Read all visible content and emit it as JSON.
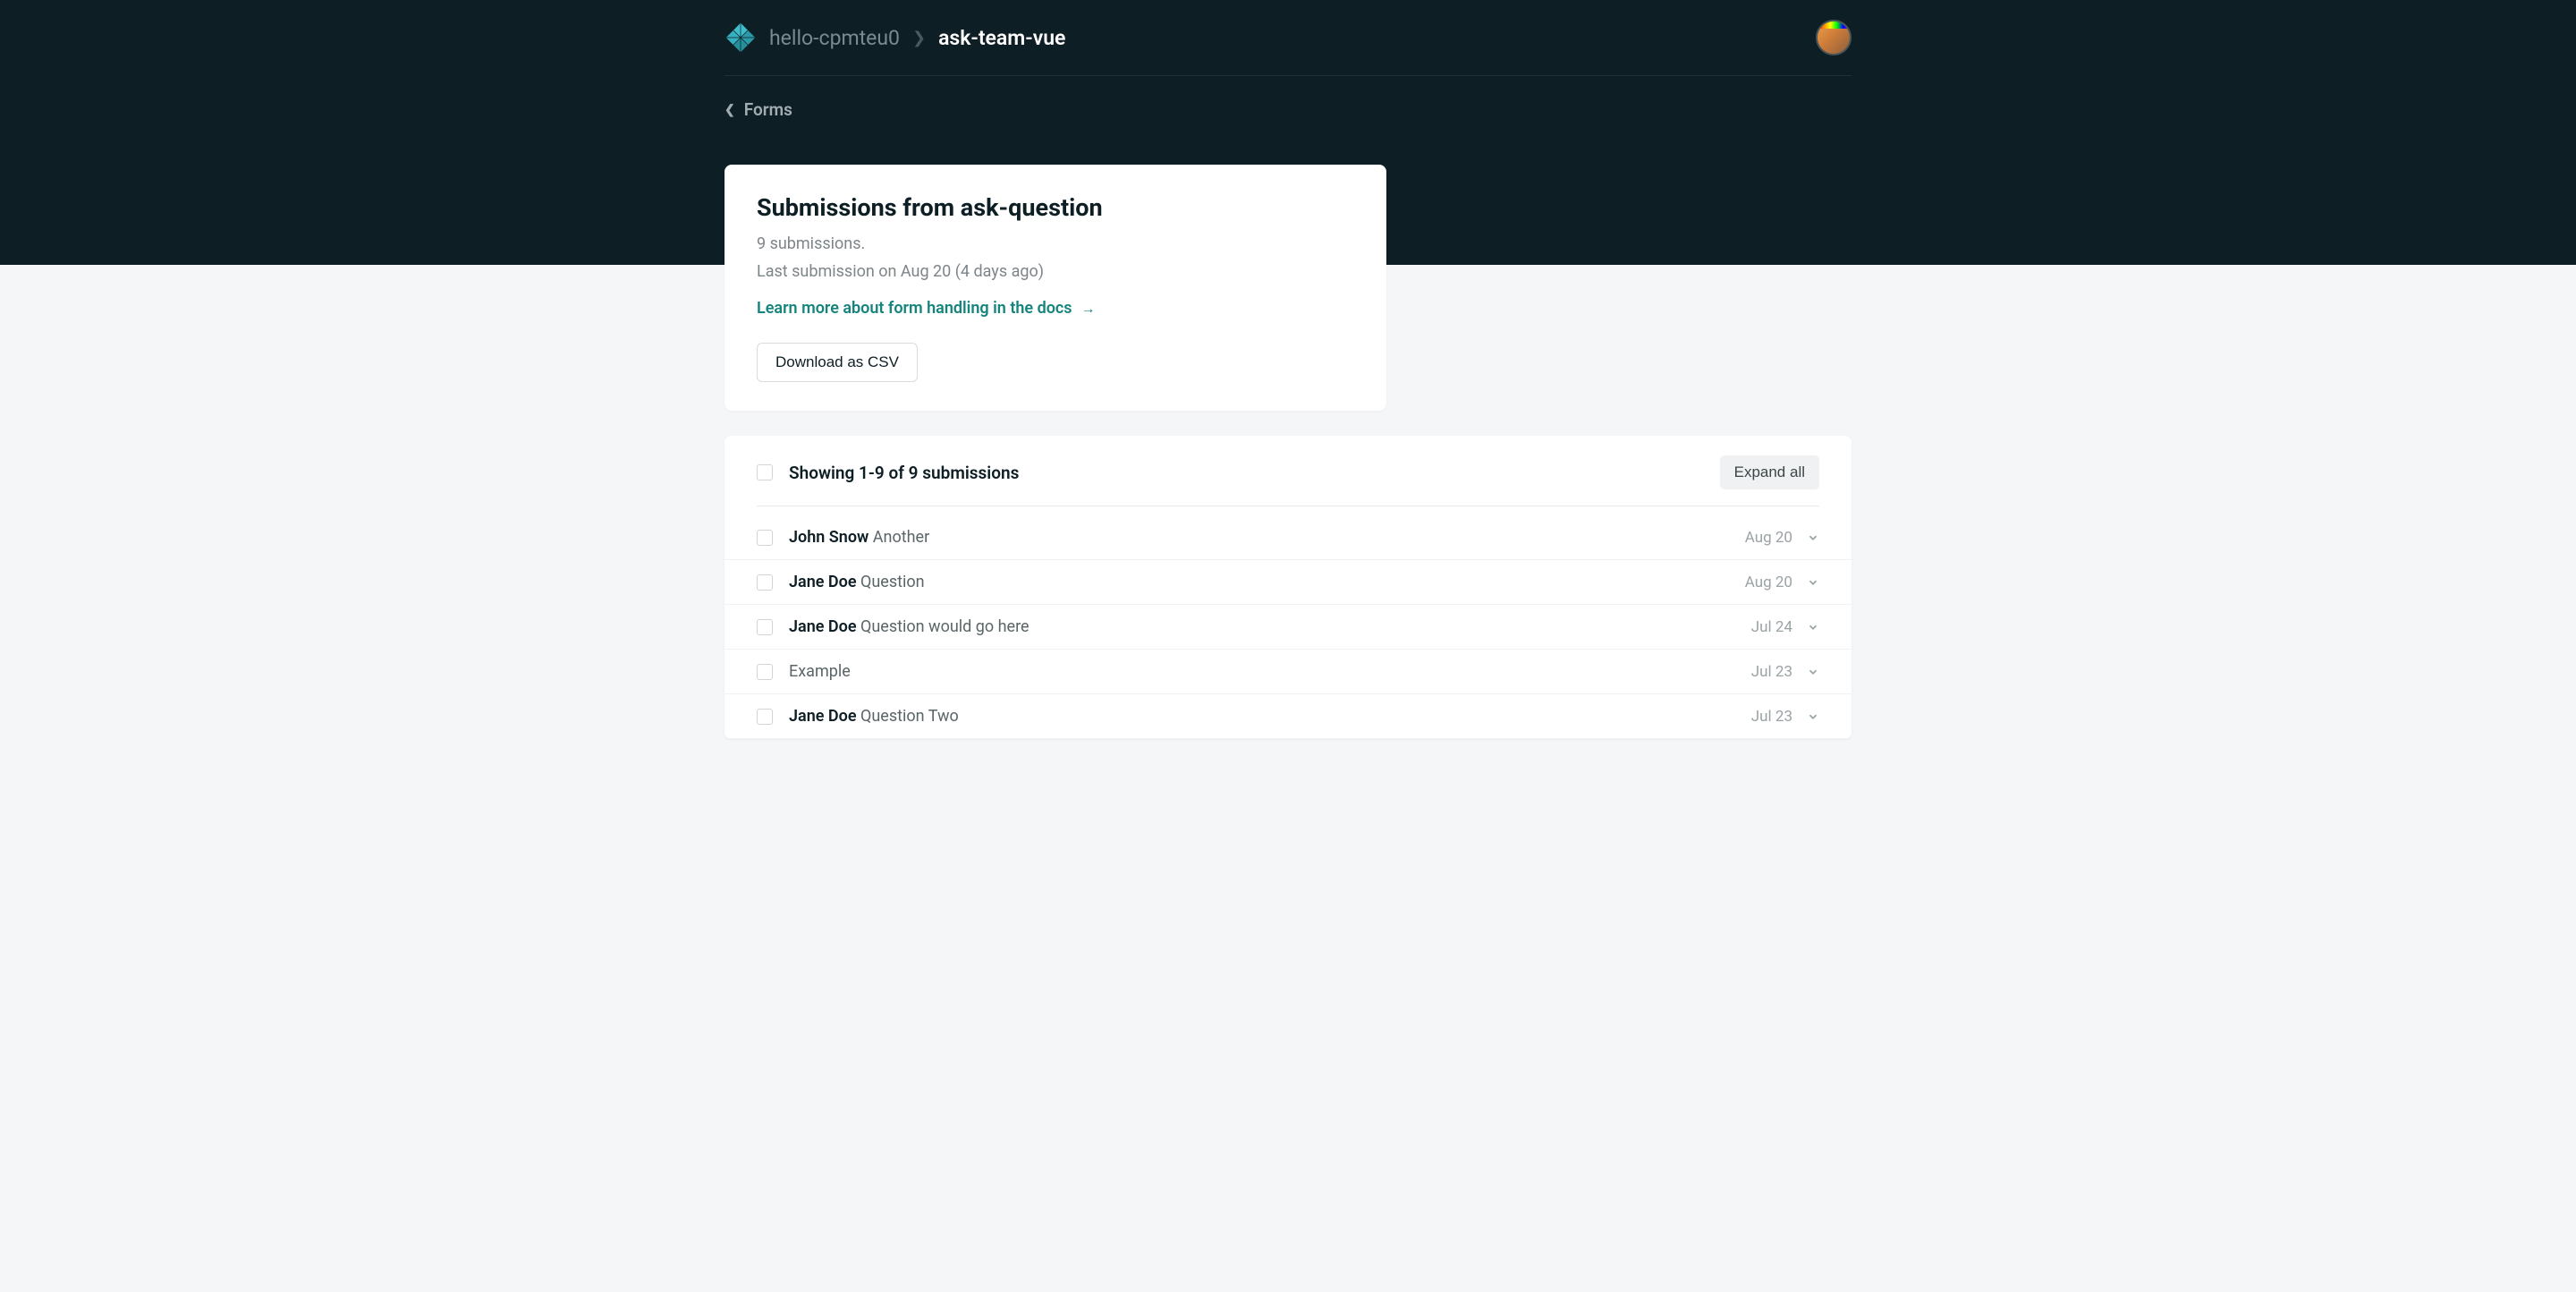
{
  "header": {
    "breadcrumb_parent": "hello-cpmteu0",
    "breadcrumb_current": "ask-team-vue",
    "back_label": "Forms"
  },
  "card": {
    "title": "Submissions from ask-question",
    "count_text": "9 submissions.",
    "last_text": "Last submission on Aug 20 (4 days ago)",
    "link_text": "Learn more about form handling in the docs",
    "download_label": "Download as CSV"
  },
  "list": {
    "header_text": "Showing 1-9 of 9 submissions",
    "expand_label": "Expand all",
    "rows": [
      {
        "name": "John Snow",
        "text": "Another",
        "date": "Aug 20"
      },
      {
        "name": "Jane Doe",
        "text": "Question",
        "date": "Aug 20"
      },
      {
        "name": "Jane Doe",
        "text": "Question would go here",
        "date": "Jul 24"
      },
      {
        "name": "",
        "text": "Example",
        "date": "Jul 23"
      },
      {
        "name": "Jane Doe",
        "text": "Question Two",
        "date": "Jul 23"
      }
    ]
  }
}
